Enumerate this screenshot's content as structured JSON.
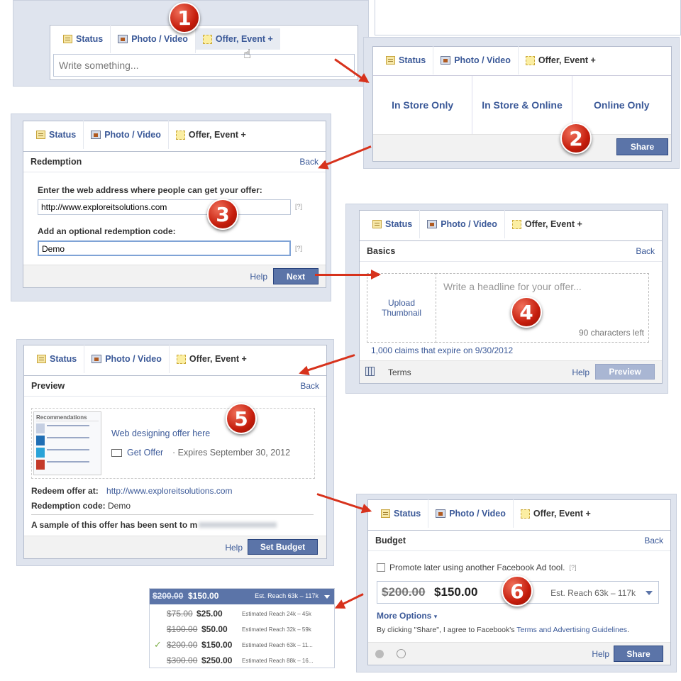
{
  "tabs": {
    "status": "Status",
    "photo": "Photo / Video",
    "offer": "Offer, Event +"
  },
  "step_numbers": [
    "1",
    "2",
    "3",
    "4",
    "5",
    "6"
  ],
  "step1": {
    "placeholder": "Write something..."
  },
  "step2": {
    "options": [
      "In Store Only",
      "In Store & Online",
      "Online Only"
    ],
    "share": "Share"
  },
  "step3": {
    "title": "Redemption",
    "back": "Back",
    "url_label": "Enter the web address where people can get your offer:",
    "url_value": "http://www.exploreitsolutions.com",
    "code_label": "Add an optional redemption code:",
    "code_value": "Demo",
    "help_marker": "[?]",
    "help": "Help",
    "next": "Next"
  },
  "step4": {
    "title": "Basics",
    "back": "Back",
    "upload": "Upload Thumbnail",
    "headline_placeholder": "Write a headline for your offer...",
    "chars_left": "90 characters left",
    "claims": "1,000 claims that expire on",
    "expire_date": "9/30/2012",
    "terms": "Terms",
    "help": "Help",
    "preview": "Preview"
  },
  "step5": {
    "title": "Preview",
    "back": "Back",
    "offer_title": "Web designing offer here",
    "get_offer": "Get Offer",
    "expires": "· Expires September 30, 2012",
    "redeem_label": "Redeem offer at:",
    "redeem_url": "http://www.exploreitsolutions.com",
    "code_label": "Redemption code:",
    "code_value": "Demo",
    "sample_note": "A sample of this offer has been sent to m",
    "help": "Help",
    "set_budget": "Set Budget",
    "thumb_heading": "Recommendations"
  },
  "step6": {
    "title": "Budget",
    "back": "Back",
    "promote_later": "Promote later using another Facebook Ad tool.",
    "help_marker": "[?]",
    "old_price": "$200.00",
    "new_price": "$150.00",
    "reach": "Est. Reach 63k – 117k",
    "more_options": "More Options",
    "agree_prefix": "By clicking \"Share\", I agree to Facebook's",
    "agree_link": "Terms and Advertising Guidelines",
    "help": "Help",
    "share": "Share"
  },
  "budget_dropdown": {
    "header_old": "$200.00",
    "header_new": "$150.00",
    "header_reach": "Est. Reach 63k – 117k",
    "items": [
      {
        "old": "$75.00",
        "new": "$25.00",
        "reach": "Estimated Reach 24k – 45k",
        "selected": false
      },
      {
        "old": "$100.00",
        "new": "$50.00",
        "reach": "Estimated Reach 32k – 59k",
        "selected": false
      },
      {
        "old": "$200.00",
        "new": "$150.00",
        "reach": "Estimated Reach 63k – 11...",
        "selected": true
      },
      {
        "old": "$300.00",
        "new": "$250.00",
        "reach": "Estimated Reach 88k – 16...",
        "selected": false
      }
    ]
  },
  "colors": {
    "link": "#3b5998",
    "button": "#5b74a8",
    "badge": "#c51d0c",
    "arrow": "#d7321c"
  }
}
